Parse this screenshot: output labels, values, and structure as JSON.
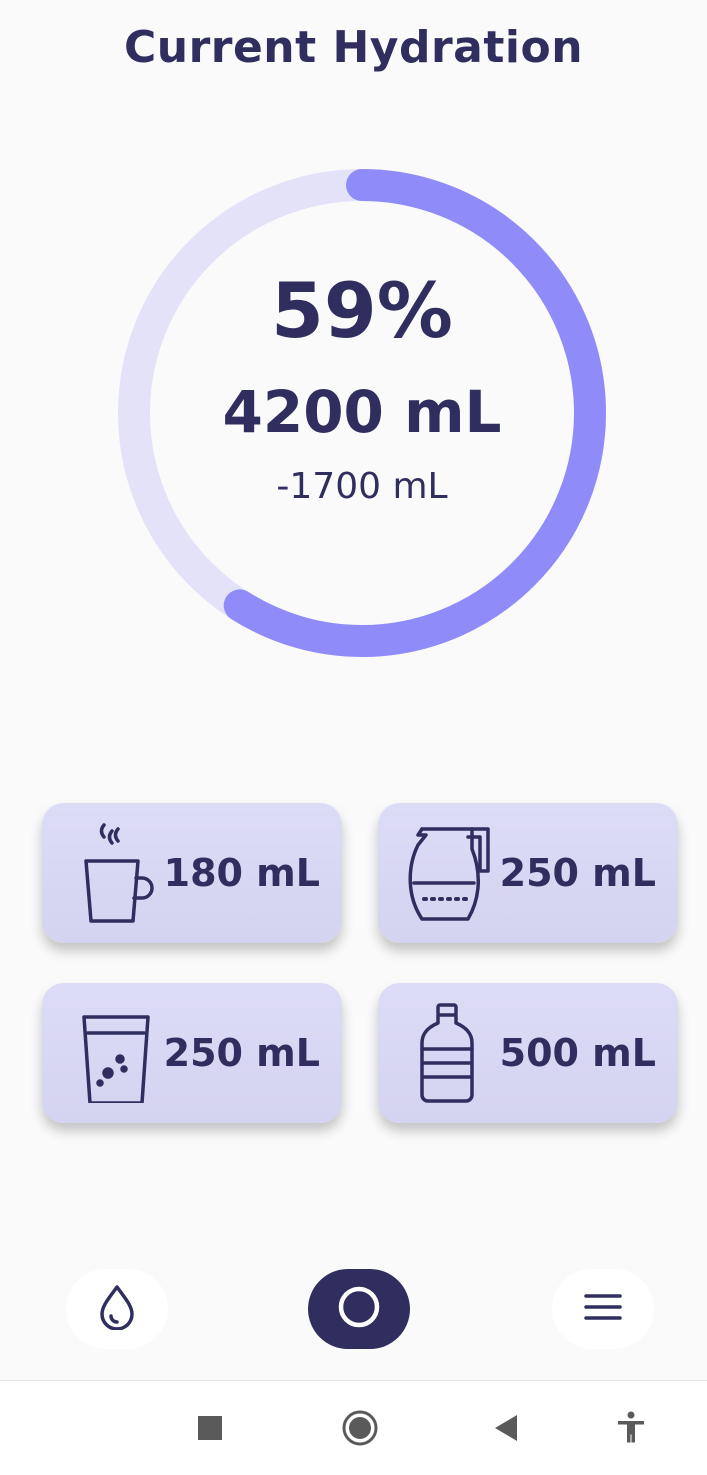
{
  "header": {
    "title": "Current Hydration"
  },
  "progress": {
    "fraction": 0.59,
    "percent_label": "59%",
    "amount_label": "4200 mL",
    "remaining_label": "-1700 mL",
    "track_color": "#e3e2f9",
    "fill_color": "#8f8cf9"
  },
  "drinks": [
    {
      "label": "180 mL",
      "icon": "coffee-mug-icon"
    },
    {
      "label": "250 mL",
      "icon": "pitcher-icon"
    },
    {
      "label": "250 mL",
      "icon": "water-glass-icon"
    },
    {
      "label": "500 mL",
      "icon": "water-bottle-icon"
    }
  ],
  "bottom_nav": [
    {
      "name": "hydration",
      "icon": "water-drop-icon",
      "active": false
    },
    {
      "name": "home",
      "icon": "circle-icon",
      "active": true
    },
    {
      "name": "menu",
      "icon": "menu-icon",
      "active": false
    }
  ],
  "system_nav": [
    {
      "name": "recents",
      "icon": "square-icon"
    },
    {
      "name": "home",
      "icon": "home-circle-icon"
    },
    {
      "name": "back",
      "icon": "back-triangle-icon"
    },
    {
      "name": "accessibility",
      "icon": "accessibility-icon"
    }
  ],
  "colors": {
    "primary": "#2f2e5f",
    "accent": "#8f8cf9",
    "card_bg": "#d9d8f4",
    "background": "#fafafa"
  }
}
